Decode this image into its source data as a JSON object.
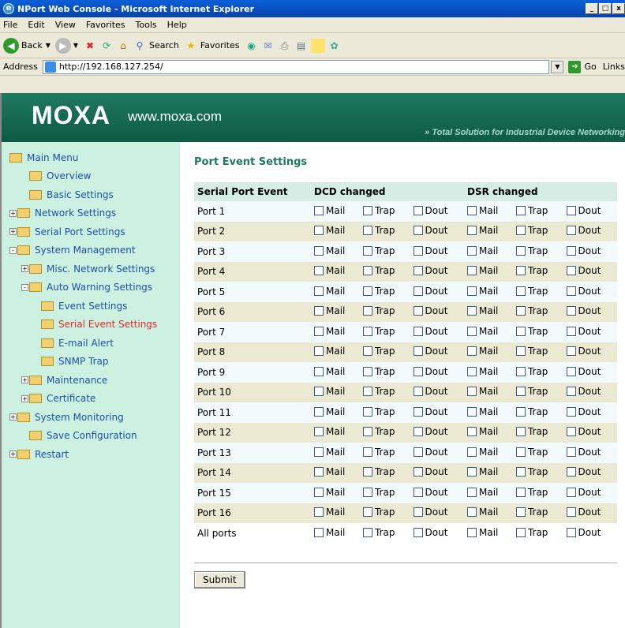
{
  "window": {
    "title": "NPort Web Console - Microsoft Internet Explorer",
    "minimize": "_",
    "maximize": "□",
    "close": "x"
  },
  "menu": [
    "File",
    "Edit",
    "View",
    "Favorites",
    "Tools",
    "Help"
  ],
  "toolbar": {
    "back": "Back",
    "search": "Search",
    "favorites": "Favorites"
  },
  "address": {
    "label": "Address",
    "url": "http://192.168.127.254/",
    "go": "Go",
    "links": "Links"
  },
  "banner": {
    "logo": "MOXA",
    "url": "www.moxa.com",
    "tagline": "» Total Solution for Industrial Device Networking"
  },
  "sidebar": {
    "root": "Main Menu",
    "items": [
      {
        "label": "Overview",
        "indent": 1,
        "expander": ""
      },
      {
        "label": "Basic Settings",
        "indent": 1,
        "expander": ""
      },
      {
        "label": "Network Settings",
        "indent": 0,
        "expander": "+"
      },
      {
        "label": "Serial Port Settings",
        "indent": 0,
        "expander": "+"
      },
      {
        "label": "System Management",
        "indent": 0,
        "expander": "-"
      },
      {
        "label": "Misc. Network Settings",
        "indent": 1,
        "expander": "+"
      },
      {
        "label": "Auto Warning Settings",
        "indent": 1,
        "expander": "-"
      },
      {
        "label": "Event Settings",
        "indent": 2,
        "expander": ""
      },
      {
        "label": "Serial Event Settings",
        "indent": 2,
        "expander": "",
        "active": true
      },
      {
        "label": "E-mail Alert",
        "indent": 2,
        "expander": ""
      },
      {
        "label": "SNMP Trap",
        "indent": 2,
        "expander": ""
      },
      {
        "label": "Maintenance",
        "indent": 1,
        "expander": "+"
      },
      {
        "label": "Certificate",
        "indent": 1,
        "expander": "+"
      },
      {
        "label": "System Monitoring",
        "indent": 0,
        "expander": "+"
      },
      {
        "label": "Save Configuration",
        "indent": 1,
        "expander": ""
      },
      {
        "label": "Restart",
        "indent": 0,
        "expander": "+"
      }
    ]
  },
  "page": {
    "title": "Port Event Settings",
    "headers": {
      "col1": "Serial Port Event",
      "dcd": "DCD changed",
      "dsr": "DSR changed"
    },
    "options": [
      "Mail",
      "Trap",
      "Dout"
    ],
    "rows": [
      "Port 1",
      "Port 2",
      "Port 3",
      "Port 4",
      "Port 5",
      "Port 6",
      "Port 7",
      "Port 8",
      "Port 9",
      "Port 10",
      "Port 11",
      "Port 12",
      "Port 13",
      "Port 14",
      "Port 15",
      "Port 16",
      "All ports"
    ],
    "submit": "Submit"
  }
}
